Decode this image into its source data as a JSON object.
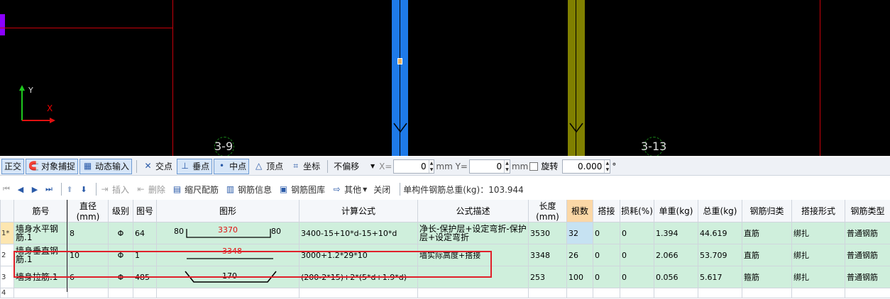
{
  "canvas": {
    "axis_labels": [
      "3-9",
      "3-13"
    ],
    "ucs": {
      "y": "Y",
      "x": "X"
    }
  },
  "toolbar1": {
    "ortho": "正交",
    "snap": "对象捕捉",
    "dyn_input": "动态输入",
    "intersect": "交点",
    "perp": "垂点",
    "mid": "中点",
    "vertex": "顶点",
    "coord": "坐标",
    "offset_mode": "不偏移",
    "x_label": "X=",
    "x_value": "0",
    "y_label": "mm Y=",
    "y_value": "0",
    "mm": "mm",
    "rotate": "旋转",
    "rotate_value": "0.000",
    "degree": "°"
  },
  "toolbar2": {
    "insert": "插入",
    "delete": "删除",
    "scale": "缩尺配筋",
    "info": "钢筋信息",
    "library": "钢筋图库",
    "other": "其他",
    "close": "关闭",
    "total_label": "单构件钢筋总重(kg)：103.944"
  },
  "grid": {
    "columns": [
      "筋号",
      "直径(mm)",
      "级别",
      "图号",
      "图形",
      "计算公式",
      "公式描述",
      "长度(mm)",
      "根数",
      "搭接",
      "损耗(%)",
      "单重(kg)",
      "总重(kg)",
      "钢筋归类",
      "搭接形式",
      "钢筋类型"
    ],
    "rows": [
      {
        "idx": "1*",
        "name": "墙身水平钢筋.1",
        "dia": "8",
        "grade": "Φ",
        "fig": "64",
        "shape_left": "80",
        "shape_mid": "3370",
        "shape_right": "80",
        "formula": "3400-15+10*d-15+10*d",
        "desc": "净长-保护层+设定弯折-保护层+设定弯折",
        "length": "3530",
        "count": "32",
        "lap": "0",
        "loss": "0",
        "unit_w": "1.394",
        "total_w": "44.619",
        "category": "直筋",
        "lap_type": "绑扎",
        "rebar_type": "普通钢筋"
      },
      {
        "idx": "2",
        "name": "墙身垂直钢筋.1",
        "dia": "10",
        "grade": "Φ",
        "fig": "1",
        "shape_mid": "3348",
        "formula": "3000+1.2*29*10",
        "desc": "墙实际高度+搭接",
        "length": "3348",
        "count": "26",
        "lap": "0",
        "loss": "0",
        "unit_w": "2.066",
        "total_w": "53.709",
        "category": "直筋",
        "lap_type": "绑扎",
        "rebar_type": "普通钢筋"
      },
      {
        "idx": "3",
        "name": "墙身拉筋.1",
        "dia": "6",
        "grade": "Φ",
        "fig": "485",
        "shape_mid": "170",
        "formula": "(200-2*15)+2*(5*d+1.9*d)",
        "desc": "",
        "length": "253",
        "count": "100",
        "lap": "0",
        "loss": "0",
        "unit_w": "0.056",
        "total_w": "5.617",
        "category": "箍筋",
        "lap_type": "绑扎",
        "rebar_type": "普通钢筋"
      }
    ],
    "empty_idx": "4"
  }
}
